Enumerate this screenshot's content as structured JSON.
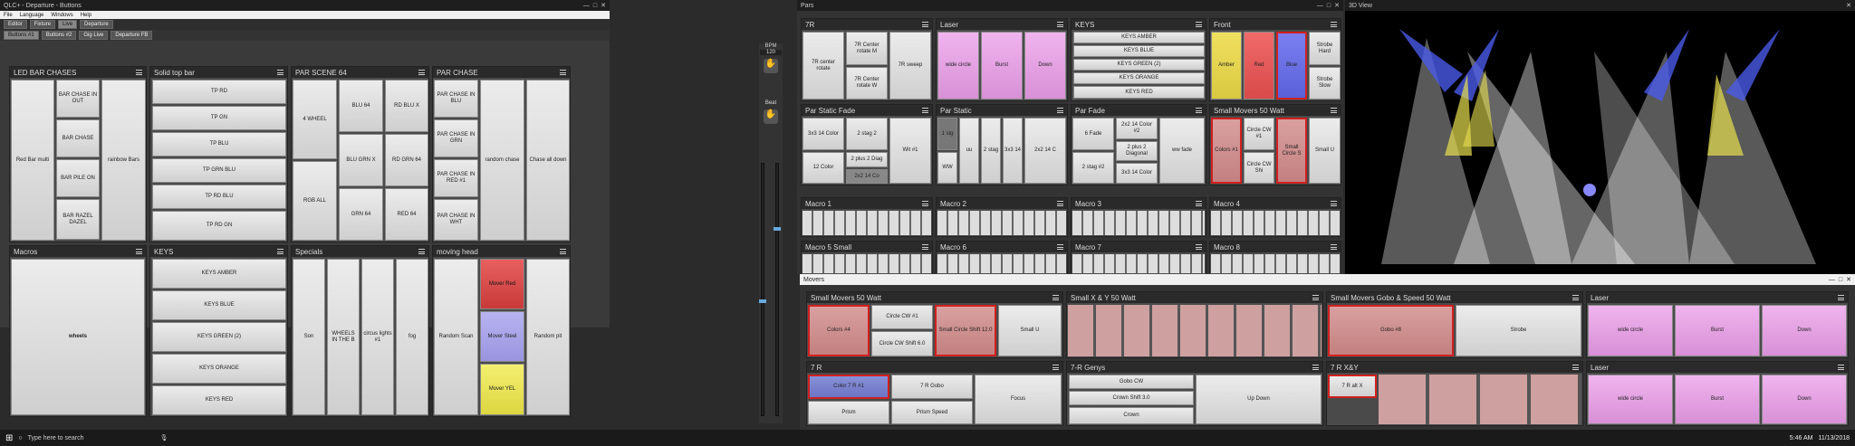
{
  "main_window": {
    "title": "QLC+ - Departure - Buttons",
    "menu": [
      "File",
      "Language",
      "Windows",
      "Help"
    ],
    "tabs": [
      "Editor",
      "Fixture",
      "Live",
      "Departure"
    ],
    "page_tabs": [
      "Buttons #1",
      "Buttons #2",
      "Gig Live",
      "Departure FB"
    ]
  },
  "led_chases": {
    "title": "LED BAR CHASES",
    "buttons": [
      "Red Bar multi",
      "BAR CHASE IN OUT",
      "BAR CHASE",
      "BAR PILE ON",
      "BAR RAZEL DAZEL",
      "rainbow Bars"
    ]
  },
  "solid_top": {
    "title": "Solid top bar",
    "buttons": [
      "TP RD",
      "TP GN",
      "TP BLU",
      "TP GRN BLU",
      "TP RD BLU",
      "TP RD GN"
    ]
  },
  "par_scene": {
    "title": "PAR SCENE 64",
    "buttons": [
      "4 WHEEL",
      "BLU 64",
      "RD BLU X",
      "BLU GRN X",
      "RD GRN 64",
      "RGB ALL",
      "GRN 64",
      "RED 64"
    ]
  },
  "par_chase": {
    "title": "PAR CHASE",
    "buttons": [
      "PAR CHASE IN BLU",
      "PAR CHASE IN GRN",
      "PAR CHASE IN RED #1",
      "PAR CHASE IN WHT",
      "random chase",
      "Chase all down"
    ]
  },
  "macros": {
    "title": "Macros",
    "buttons": [
      "wheels"
    ]
  },
  "keys": {
    "title": "KEYS",
    "buttons": [
      "KEYS AMBER",
      "KEYS BLUE",
      "KEYS GREEN (2)",
      "KEYS ORANGE",
      "KEYS RED"
    ]
  },
  "specials": {
    "title": "Specials",
    "buttons": [
      "Son",
      "WHEELS IN THE B",
      "circus lights #1",
      "fog"
    ]
  },
  "moving_head": {
    "title": "moving head",
    "buttons": [
      "Random Scan",
      "Mover Red",
      "Mover Steel",
      "Mover YEL",
      "Random pit"
    ]
  },
  "side": {
    "bpm_label": "BPM",
    "bpm_value": "120",
    "beat_label": "Beat"
  },
  "pars_window": {
    "title": "Pars",
    "frames": {
      "r7": {
        "title": "7R",
        "buttons": [
          "7R center rotate",
          "7R Center rotate M",
          "7R Center rotate W",
          "7R sweep"
        ]
      },
      "laser": {
        "title": "Laser",
        "buttons": [
          "wide circle",
          "Burst",
          "Down"
        ]
      },
      "keys": {
        "title": "KEYS",
        "buttons": [
          "KEYS AMBER",
          "KEYS BLUE",
          "KEYS GREEN (2)",
          "KEYS ORANGE",
          "KEYS RED"
        ]
      },
      "front": {
        "title": "Front",
        "buttons": [
          "Amber",
          "Red",
          "Blue",
          "Strobe Hard",
          "Strobe Slow"
        ]
      },
      "par_static_fade": {
        "title": "Par Static Fade",
        "buttons": [
          "3x3 14 Color",
          "2 stag 2",
          "12 Color",
          "2 plus 2 Diag",
          "Wit #1",
          "2x2 14 Co"
        ]
      },
      "par_static": {
        "title": "Par Static",
        "buttons": [
          "1 stg",
          "WW",
          "uu",
          "2 stag",
          "3x3 14",
          "2x2 14 C"
        ]
      },
      "par_fade": {
        "title": "Par Fade",
        "buttons": [
          "6 Fade",
          "2x2 14 Color #2",
          "2 stag #2",
          "3x3 14 Color",
          "2 plus 2 Diagonal",
          "ww fade"
        ]
      },
      "small_movers": {
        "title": "Small Movers 50 Watt",
        "buttons": [
          "Colors #1",
          "Circle CW #1",
          "Circle CW Shi",
          "Small Circle S",
          "Small U"
        ]
      },
      "macro1": {
        "title": "Macro 1"
      },
      "macro2": {
        "title": "Macro 2"
      },
      "macro3": {
        "title": "Macro 3"
      },
      "macro4": {
        "title": "Macro 4"
      },
      "macro5": {
        "title": "Macro 5 Small"
      },
      "macro6": {
        "title": "Macro 6"
      },
      "macro7": {
        "title": "Macro 7"
      },
      "macro8": {
        "title": "Macro 8"
      }
    }
  },
  "movers_window": {
    "title": "Movers",
    "frames": {
      "small_movers": {
        "title": "Small Movers 50 Watt",
        "buttons": [
          "Colors #4",
          "Circle CW #1",
          "Small Circle Shift 12.0",
          "Small U",
          "Circle CW Shift 6.0"
        ]
      },
      "smallxy": {
        "title": "Small X & Y 50 Watt"
      },
      "gobo": {
        "title": "Small Movers Gobo & Speed 50 Watt",
        "buttons": [
          "Gobo #8",
          "Strobe"
        ]
      },
      "laser": {
        "title": "Laser",
        "buttons": [
          "wide circle",
          "Burst",
          "Down"
        ]
      },
      "r7": {
        "title": "7 R",
        "buttons": [
          "Color 7 R #1",
          "7 R Gobo",
          "Prism",
          "Prism Speed",
          "Focus"
        ]
      },
      "r7g": {
        "title": "7-R Genys",
        "buttons": [
          "Gobo CW",
          "Crown Shift 3.0",
          "Crown",
          "Up Down"
        ]
      },
      "r7xy": {
        "title": "7 R X&Y",
        "buttons": [
          "7 R alt X"
        ]
      },
      "laser2": {
        "title": "Laser",
        "buttons": [
          "wide circle",
          "Burst",
          "Down"
        ]
      }
    }
  },
  "stage_window": {
    "title": "3D View"
  },
  "taskbar": {
    "search": "Type here to search",
    "time": "5:46 AM",
    "date": "11/13/2018"
  }
}
